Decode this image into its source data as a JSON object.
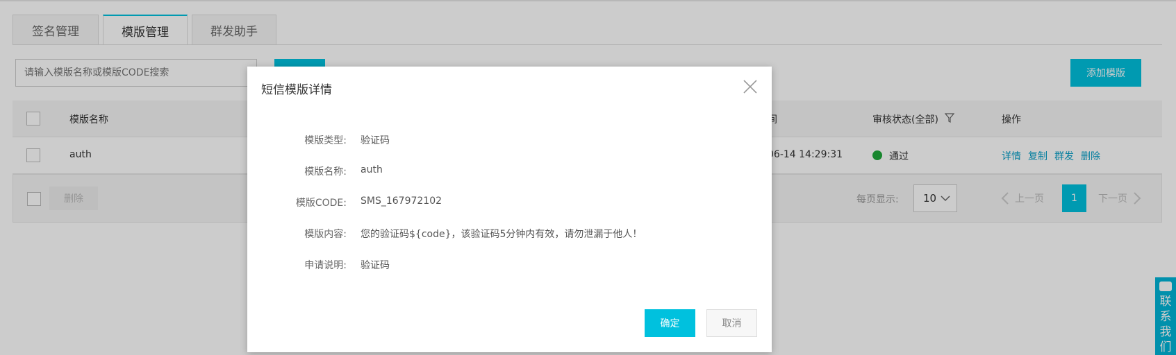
{
  "tabs": [
    "签名管理",
    "模版管理",
    "群发助手"
  ],
  "search": {
    "placeholder": "请输入模版名称或模版CODE搜索"
  },
  "toolbar": {
    "add_label": "添加模版"
  },
  "table": {
    "headers": {
      "name": "模版名称",
      "time": "间",
      "status": "审核状态(全部)",
      "ops": "操作"
    },
    "rows": [
      {
        "name": "auth",
        "time": "06-14 14:29:31",
        "status": "通过",
        "ops": [
          "详情",
          "复制",
          "群发",
          "删除"
        ]
      }
    ]
  },
  "footer": {
    "delete_label": "删除",
    "page_size_label": "每页显示:",
    "page_size": "10",
    "prev_label": "上一页",
    "current_page": "1",
    "next_label": "下一页"
  },
  "float_contact": [
    "联",
    "系",
    "我",
    "们"
  ],
  "modal": {
    "title": "短信模版详情",
    "fields": [
      {
        "label": "模版类型:",
        "value": "验证码"
      },
      {
        "label": "模版名称:",
        "value": "auth"
      },
      {
        "label": "模版CODE:",
        "value": "SMS_167972102"
      },
      {
        "label": "模版内容:",
        "value": "您的验证码${code}，该验证码5分钟内有效，请勿泄漏于他人！"
      },
      {
        "label": "申请说明:",
        "value": "验证码"
      }
    ],
    "ok_label": "确定",
    "cancel_label": "取消"
  },
  "colors": {
    "accent": "#00c1de",
    "status_ok": "#1fa83a",
    "link": "#0aa0c8"
  }
}
